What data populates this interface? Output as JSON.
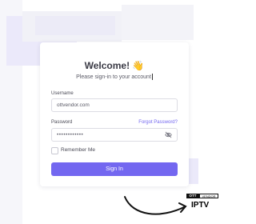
{
  "login": {
    "title": "Welcome! 👋",
    "subtitle": "Please sign-in to your account",
    "username_label": "Username",
    "username_value": "ottvendor.com",
    "password_label": "Password",
    "forgot_link": "Forgot Password?",
    "password_value": "••••••••••••",
    "remember_label": "Remember Me",
    "signin_button": "Sign In"
  },
  "brand": {
    "badge_left": "OTT",
    "badge_right": "VENDOR",
    "product": "IPTV"
  },
  "icons": {
    "password_toggle": "eye-off-icon",
    "annotation": "curved-arrow-icon"
  },
  "colors": {
    "accent": "#7367f0",
    "background_tint": "#ebe9fa"
  }
}
